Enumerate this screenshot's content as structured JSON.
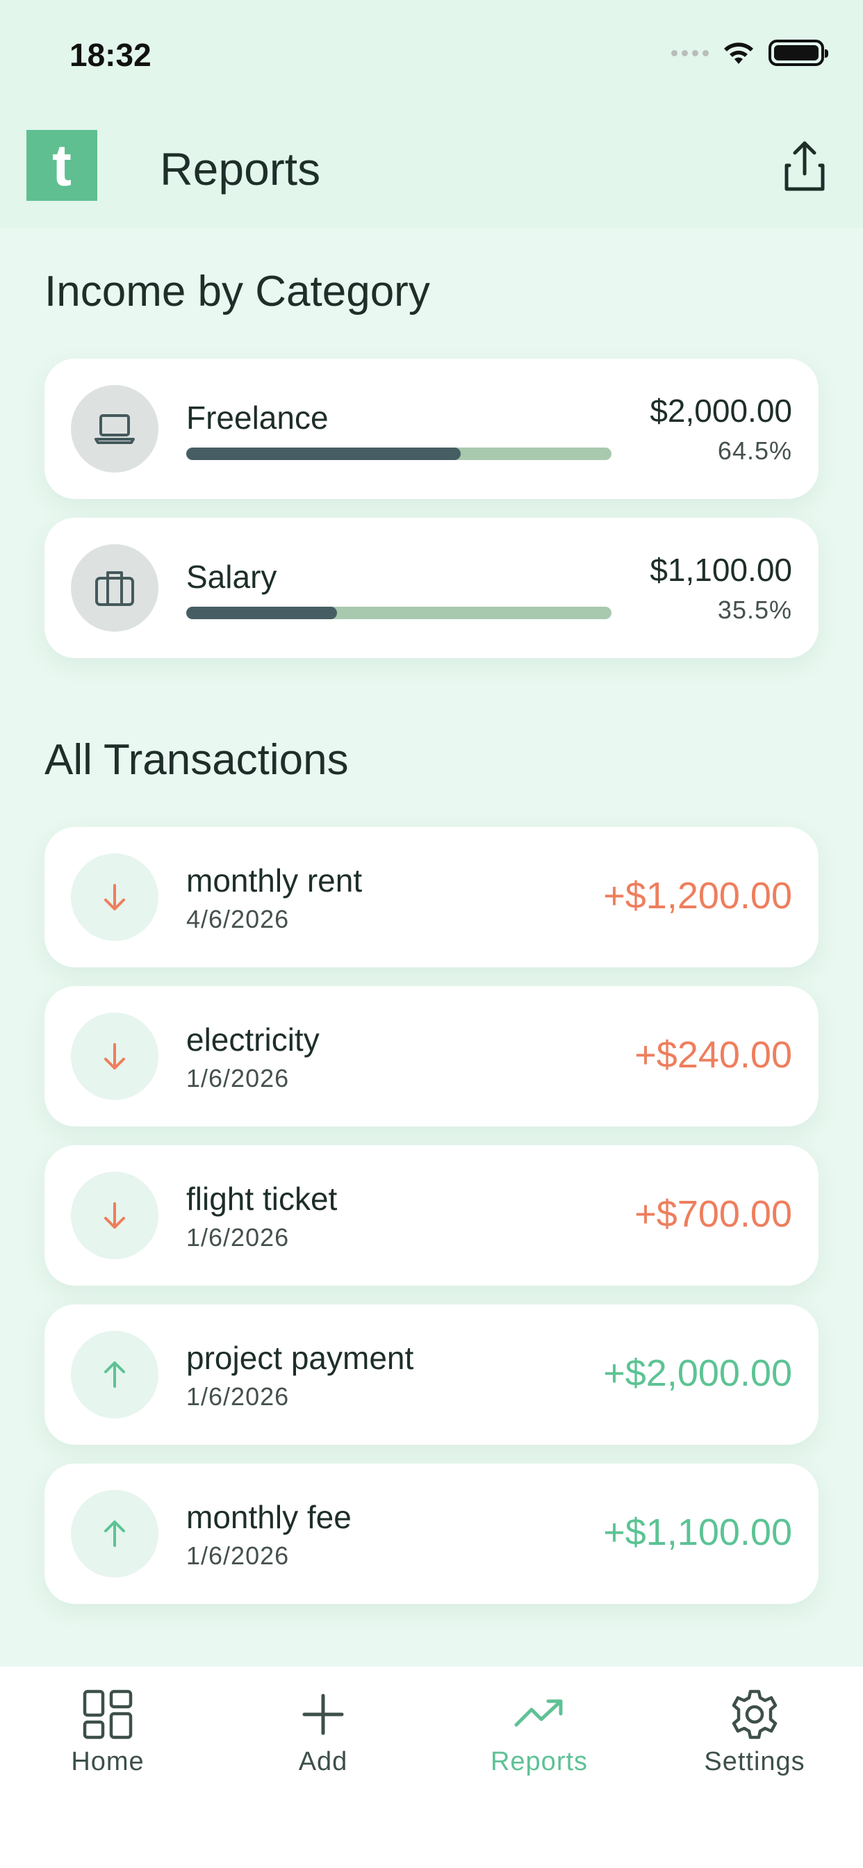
{
  "status_bar": {
    "time": "18:32"
  },
  "header": {
    "logo_letter": "t",
    "title": "Reports",
    "share_icon": "share-icon"
  },
  "income_section": {
    "title": "Income by Category",
    "categories": [
      {
        "name": "Freelance",
        "amount": "$2,000.00",
        "percent": "64.5%",
        "share": 0.645,
        "icon": "laptop-icon"
      },
      {
        "name": "Salary",
        "amount": "$1,100.00",
        "percent": "35.5%",
        "share": 0.355,
        "icon": "briefcase-icon"
      }
    ]
  },
  "transactions_section": {
    "title": "All Transactions",
    "items": [
      {
        "name": "monthly rent",
        "date": "4/6/2026",
        "amount": "+$1,200.00",
        "direction": "out",
        "icon": "arrow-down-icon"
      },
      {
        "name": "electricity",
        "date": "1/6/2026",
        "amount": "+$240.00",
        "direction": "out",
        "icon": "arrow-down-icon"
      },
      {
        "name": "flight ticket",
        "date": "1/6/2026",
        "amount": "+$700.00",
        "direction": "out",
        "icon": "arrow-down-icon"
      },
      {
        "name": "project payment",
        "date": "1/6/2026",
        "amount": "+$2,000.00",
        "direction": "in",
        "icon": "arrow-up-icon"
      },
      {
        "name": "monthly fee",
        "date": "1/6/2026",
        "amount": "+$1,100.00",
        "direction": "in",
        "icon": "arrow-up-icon"
      }
    ]
  },
  "bottom_nav": {
    "items": [
      {
        "label": "Home",
        "icon": "grid-icon",
        "active": false
      },
      {
        "label": "Add",
        "icon": "plus-icon",
        "active": false
      },
      {
        "label": "Reports",
        "icon": "trending-up-icon",
        "active": true
      },
      {
        "label": "Settings",
        "icon": "gear-icon",
        "active": false
      }
    ]
  },
  "colors": {
    "accent": "#5FBF91",
    "expense": "#EE7E5D",
    "income": "#5CC394",
    "bar_fill": "#465E63",
    "bar_track": "#A9C9AE"
  }
}
